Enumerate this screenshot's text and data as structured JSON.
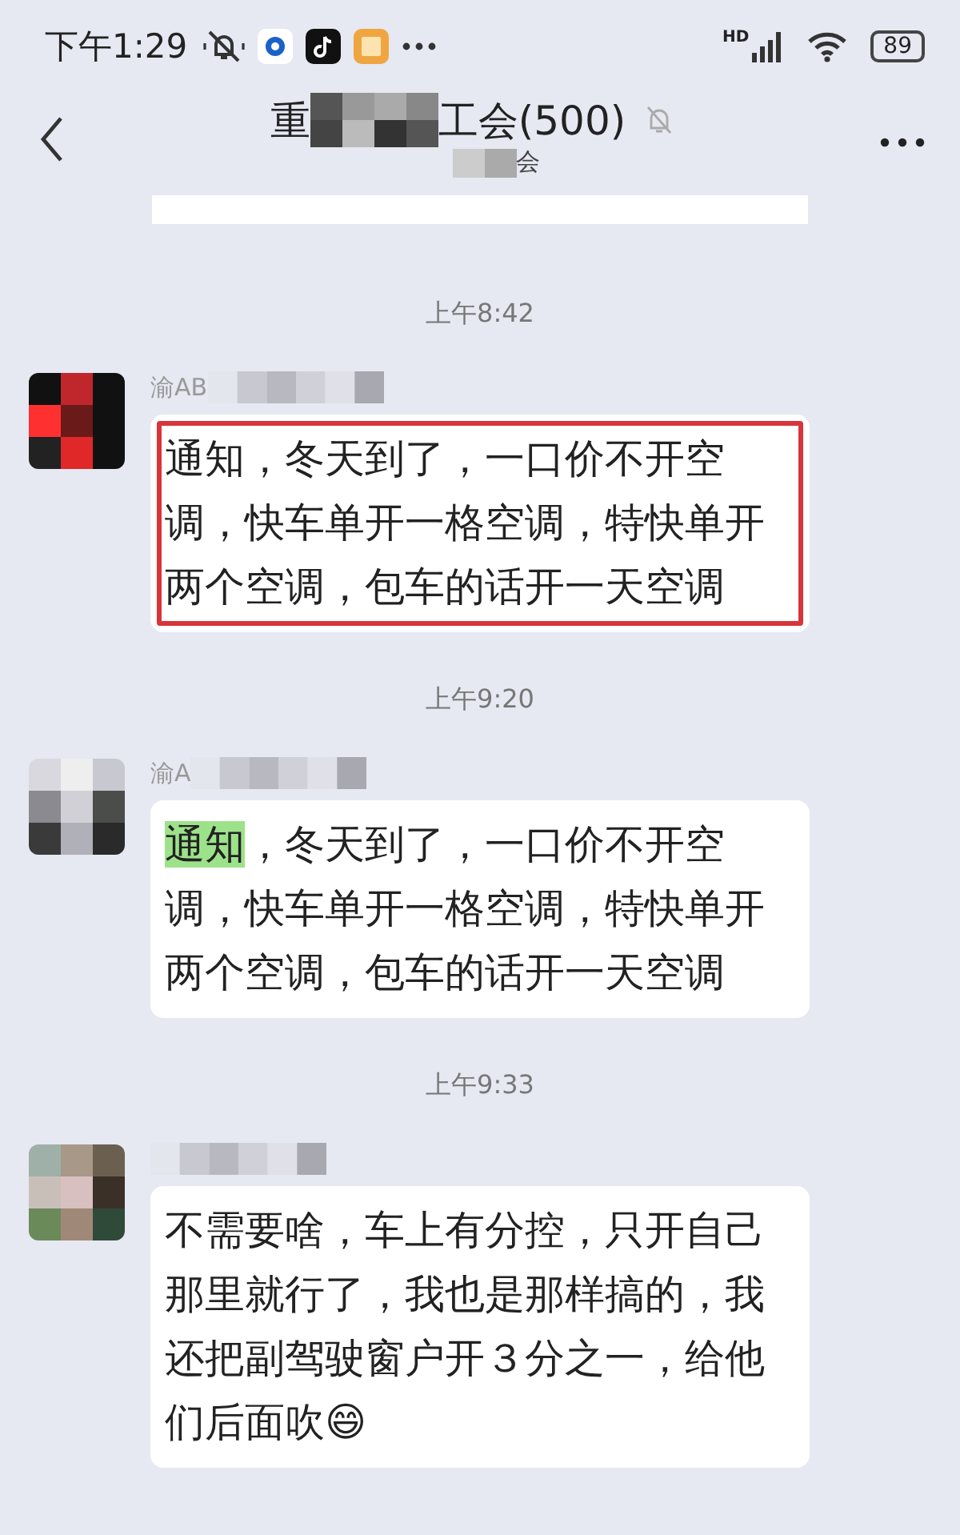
{
  "status_bar": {
    "time": "下午1:29",
    "network_label": "HD",
    "battery": "89"
  },
  "header": {
    "title_start": "重",
    "title_end": "工会(500)",
    "muted": true,
    "subtitle": "会"
  },
  "feed": [
    {
      "kind": "time",
      "text": "上午8:42"
    },
    {
      "kind": "message",
      "sender": "渝AB",
      "boxed": true,
      "parts": [
        {
          "text": "通知，冬天到了，一口价不开空调，快车单开一格空调，特快单开两个空调，包车的话开一天空调",
          "highlight": false
        }
      ]
    },
    {
      "kind": "time",
      "text": "上午9:20"
    },
    {
      "kind": "message",
      "sender": "渝A",
      "boxed": false,
      "parts": [
        {
          "text": "通知",
          "highlight": true
        },
        {
          "text": "，冬天到了，一口价不开空调，快车单开一格空调，特快单开两个空调，包车的话开一天空调",
          "highlight": false
        }
      ]
    },
    {
      "kind": "time",
      "text": "上午9:33"
    },
    {
      "kind": "message",
      "boxed": false,
      "parts": [
        {
          "text": "不需要啥，车上有分控，只开自己那里就行了，我也是那样搞的，我还把副驾驶窗户开３分之一，给他们后面吹😄",
          "highlight": false
        }
      ]
    }
  ]
}
